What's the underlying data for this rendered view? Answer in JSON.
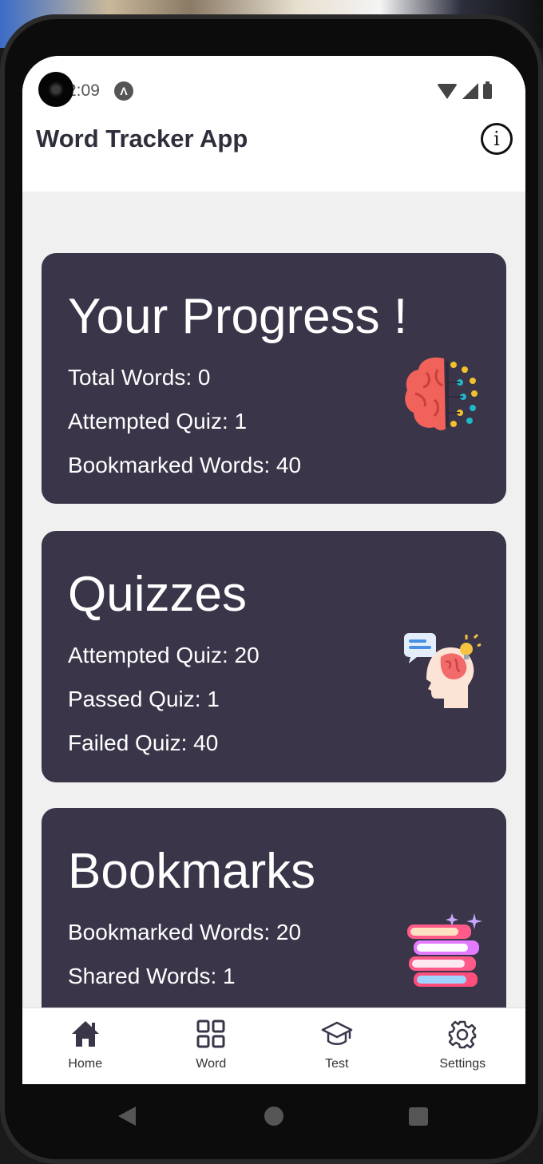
{
  "status_bar": {
    "time": "2:09",
    "app_icon_glyph": "Λ"
  },
  "app_bar": {
    "title": "Word Tracker App",
    "info_glyph": "i"
  },
  "cards": {
    "progress": {
      "title": "Your Progress !",
      "stats": [
        "Total Words: 0",
        "Attempted Quiz: 1",
        "Bookmarked Words: 40"
      ],
      "illustration": "brain-icon"
    },
    "quizzes": {
      "title": "Quizzes",
      "stats": [
        "Attempted Quiz: 20",
        "Passed Quiz: 1",
        "Failed Quiz: 40"
      ],
      "illustration": "head-idea-icon"
    },
    "bookmarks": {
      "title": "Bookmarks",
      "stats": [
        "Bookmarked Words: 20",
        "Shared Words: 1"
      ],
      "illustration": "book-stack-icon"
    }
  },
  "bottom_nav": {
    "items": [
      {
        "label": "Home",
        "icon": "home-icon"
      },
      {
        "label": "Word",
        "icon": "grid-icon"
      },
      {
        "label": "Test",
        "icon": "graduation-cap-icon"
      },
      {
        "label": "Settings",
        "icon": "gear-icon"
      }
    ]
  },
  "colors": {
    "card_bg": "#3a3548",
    "page_bg": "#f0f0f0",
    "title_text": "#2f2f3c",
    "nav_icon": "#3a3548"
  }
}
